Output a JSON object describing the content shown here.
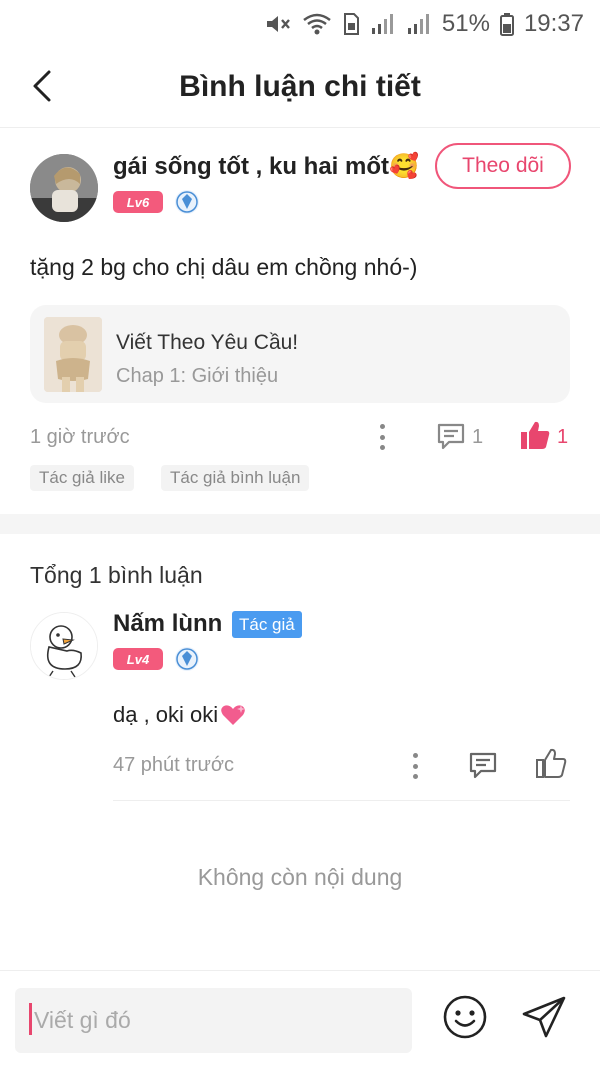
{
  "status_bar": {
    "battery": "51%",
    "time": "19:37"
  },
  "header": {
    "title": "Bình luận chi tiết",
    "back_icon": "chevron-left-icon"
  },
  "post": {
    "author": "gái sống tốt , ku hai mốt🥰",
    "follow_label": "Theo dõi",
    "level": "Lv6",
    "content": "tặng 2 bg cho chị dâu em chồng nhó-)",
    "story": {
      "title": "Viết Theo Yêu Cầu!",
      "chapter": "Chap 1: Giới thiệu"
    },
    "time": "1 giờ trước",
    "comment_count": "1",
    "like_count": "1",
    "tags": [
      "Tác giả like",
      "Tác giả bình luận"
    ]
  },
  "comments": {
    "total_label": "Tổng 1 bình luận",
    "items": [
      {
        "author": "Nấm lùnn",
        "author_tag": "Tác giả",
        "level": "Lv4",
        "text": "dạ , oki oki",
        "time": "47 phút trước"
      }
    ],
    "end_text": "Không còn nội dung"
  },
  "composer": {
    "placeholder": "Viết gì đó"
  },
  "colors": {
    "accent_pink": "#e8466e",
    "level_badge": "#f35a7c",
    "author_tag": "#4a9bf0"
  }
}
